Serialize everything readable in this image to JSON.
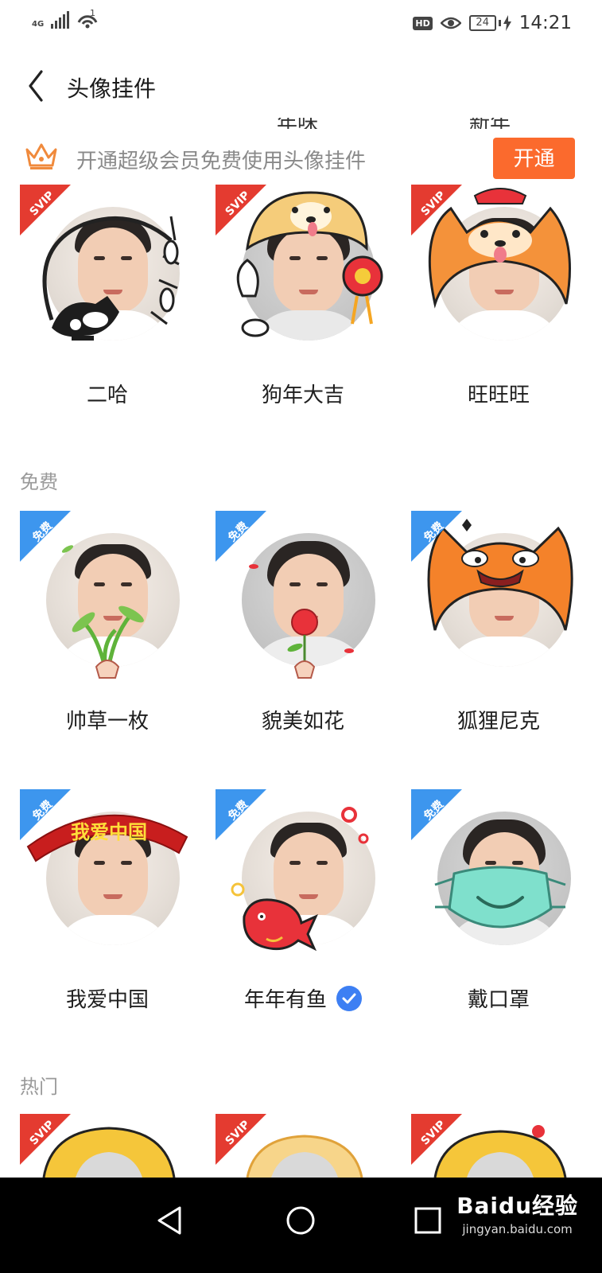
{
  "status_bar": {
    "network_label": "4G",
    "wifi_count": "1",
    "hd_badge": "HD",
    "battery_level": "24",
    "time": "14:21"
  },
  "header": {
    "title": "头像挂件"
  },
  "clipped_labels": [
    "年味",
    "新年"
  ],
  "vip_banner": {
    "text": "开通超级会员免费使用头像挂件",
    "button_label": "开通"
  },
  "sections": {
    "free_title": "免费",
    "hot_title": "热门"
  },
  "badges": {
    "svip": "SVIP",
    "free": "免费"
  },
  "svip_items": [
    {
      "label": "二哈"
    },
    {
      "label": "狗年大吉"
    },
    {
      "label": "旺旺旺"
    }
  ],
  "free_items_row1": [
    {
      "label": "帅草一枚"
    },
    {
      "label": "貌美如花"
    },
    {
      "label": "狐狸尼克"
    }
  ],
  "free_items_row2": [
    {
      "label": "我爱中国",
      "banner_text": "我爱中国"
    },
    {
      "label": "年年有鱼",
      "selected": true
    },
    {
      "label": "戴口罩"
    }
  ],
  "watermark": {
    "main": "Baidu经验",
    "sub": "jingyan.baidu.com"
  },
  "colors": {
    "svip_badge": "#e43b30",
    "free_badge": "#3d96ee",
    "accent_orange": "#fb6a2d",
    "selected_check": "#3d7ff3"
  }
}
